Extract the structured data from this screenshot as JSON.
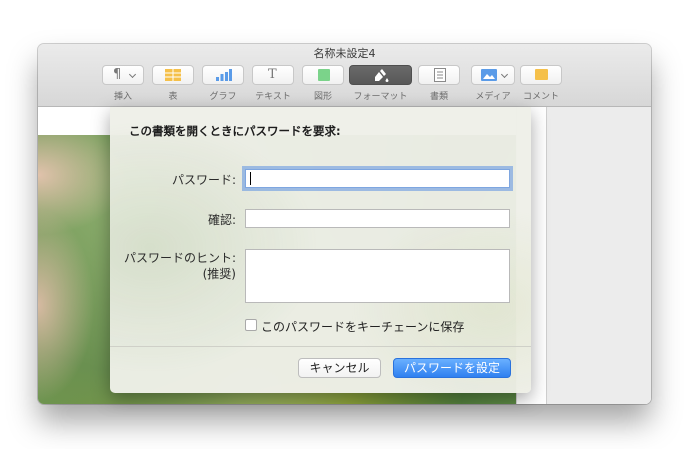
{
  "window": {
    "title": "名称未設定4"
  },
  "toolbar": {
    "items": [
      {
        "label": "挿入",
        "icon": "paragraph-icon"
      },
      {
        "label": "表",
        "icon": "table-icon"
      },
      {
        "label": "グラフ",
        "icon": "chart-icon"
      },
      {
        "label": "テキスト",
        "icon": "text-icon"
      },
      {
        "label": "図形",
        "icon": "shape-icon"
      },
      {
        "label": "フォーマット",
        "icon": "format-brush-icon",
        "active": true
      },
      {
        "label": "書類",
        "icon": "document-icon"
      },
      {
        "label": "メディア",
        "icon": "media-icon"
      },
      {
        "label": "コメント",
        "icon": "comment-icon"
      }
    ],
    "insert_glyph": "¶",
    "text_glyph": "T"
  },
  "dialog": {
    "title": "この書類を開くときにパスワードを要求:",
    "password_label": "パスワード:",
    "password_value": "",
    "verify_label": "確認:",
    "verify_value": "",
    "hint_label_line1": "パスワードのヒント:",
    "hint_label_line2": "(推奨)",
    "hint_value": "",
    "save_checkbox_label": "このパスワードをキーチェーンに保存",
    "save_checkbox_checked": false,
    "cancel_label": "キャンセル",
    "confirm_label": "パスワードを設定"
  },
  "colors": {
    "accent": "#2f80f0",
    "focus_ring": "#5c91e1",
    "active_tool": "#5e5e5e"
  }
}
